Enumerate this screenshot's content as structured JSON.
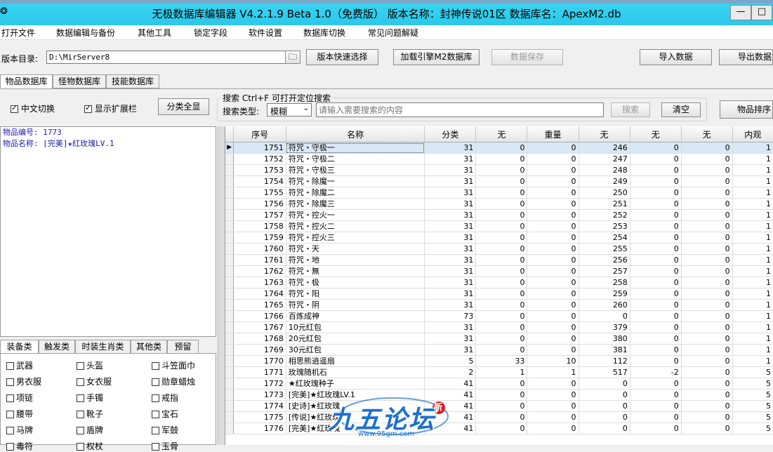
{
  "window": {
    "title": "无极数据库编辑器 V4.2.1.9    Beta 1.0（免费版）    版本名称：封神传说01区    数据库名：ApexM2.db",
    "minimize": "—",
    "maximize": "□"
  },
  "menu": [
    "打开文件",
    "数据编辑与备份",
    "其他工具",
    "锁定字段",
    "软件设置",
    "数据库切换",
    "常见问题解疑"
  ],
  "toolbar": {
    "dir_label": "版本目录:",
    "dir_value": "D:\\MirServer8",
    "quick_select": "版本快速选择",
    "load_db": "加载引擎M2数据库",
    "save_data": "数据保存",
    "import": "导入数据",
    "export": "导出数据"
  },
  "db_tabs": [
    "物品数据库",
    "怪物数据库",
    "技能数据库"
  ],
  "options": {
    "chinese_switch": "中文切换",
    "show_extension": "显示扩展栏",
    "show_all_categories": "分类全显"
  },
  "search": {
    "title": "搜索  Ctrl+F 可打开定位搜索",
    "type_label": "搜索类型:",
    "type_value": "模糊",
    "placeholder": "请输入需要搜索的内容",
    "search_btn": "搜索",
    "clear_btn": "清空",
    "sort_btn": "物品排序"
  },
  "info": {
    "line1": "物品编号: 1773",
    "line2": "物品名称: [完美]★红玫瑰LV.1"
  },
  "category_tabs": [
    "装备类",
    "触发类",
    "时装生肖类",
    "其他类",
    "预留"
  ],
  "category_items": [
    [
      "武器",
      "头盔",
      "斗笠面巾"
    ],
    [
      "男衣服",
      "女衣服",
      "勋章蜡烛"
    ],
    [
      "项链",
      "手镯",
      "戒指"
    ],
    [
      "腰带",
      "靴子",
      "宝石"
    ],
    [
      "马牌",
      "盾牌",
      "军鼓"
    ],
    [
      "毒符",
      "权杖",
      "玉骨"
    ]
  ],
  "grid": {
    "columns": [
      "序号",
      "名称",
      "分类",
      "无",
      "重量",
      "无",
      "无",
      "无",
      "内观"
    ],
    "rows": [
      [
        "1751",
        "符咒・守极一",
        "31",
        "0",
        "0",
        "246",
        "0",
        "0",
        "1"
      ],
      [
        "1752",
        "符咒・守极二",
        "31",
        "0",
        "0",
        "247",
        "0",
        "0",
        "1"
      ],
      [
        "1753",
        "符咒・守极三",
        "31",
        "0",
        "0",
        "248",
        "0",
        "0",
        "1"
      ],
      [
        "1754",
        "符咒・除魔一",
        "31",
        "0",
        "0",
        "249",
        "0",
        "0",
        "1"
      ],
      [
        "1755",
        "符咒・除魔二",
        "31",
        "0",
        "0",
        "250",
        "0",
        "0",
        "1"
      ],
      [
        "1756",
        "符咒・除魔三",
        "31",
        "0",
        "0",
        "251",
        "0",
        "0",
        "1"
      ],
      [
        "1757",
        "符咒・控火一",
        "31",
        "0",
        "0",
        "252",
        "0",
        "0",
        "1"
      ],
      [
        "1758",
        "符咒・控火二",
        "31",
        "0",
        "0",
        "253",
        "0",
        "0",
        "1"
      ],
      [
        "1759",
        "符咒・控火三",
        "31",
        "0",
        "0",
        "254",
        "0",
        "0",
        "1"
      ],
      [
        "1760",
        "符咒・天",
        "31",
        "0",
        "0",
        "255",
        "0",
        "0",
        "1"
      ],
      [
        "1761",
        "符咒・地",
        "31",
        "0",
        "0",
        "256",
        "0",
        "0",
        "1"
      ],
      [
        "1762",
        "符咒・無",
        "31",
        "0",
        "0",
        "257",
        "0",
        "0",
        "1"
      ],
      [
        "1763",
        "符咒・极",
        "31",
        "0",
        "0",
        "258",
        "0",
        "0",
        "1"
      ],
      [
        "1764",
        "符咒・阳",
        "31",
        "0",
        "0",
        "259",
        "0",
        "0",
        "1"
      ],
      [
        "1765",
        "符咒・阴",
        "31",
        "0",
        "0",
        "260",
        "0",
        "0",
        "1"
      ],
      [
        "1766",
        "百炼成神",
        "73",
        "0",
        "0",
        "0",
        "0",
        "0",
        "1"
      ],
      [
        "1767",
        "10元红包",
        "31",
        "0",
        "0",
        "379",
        "0",
        "0",
        "1"
      ],
      [
        "1768",
        "20元红包",
        "31",
        "0",
        "0",
        "380",
        "0",
        "0",
        "1"
      ],
      [
        "1769",
        "30元红包",
        "31",
        "0",
        "0",
        "381",
        "0",
        "0",
        "1"
      ],
      [
        "1770",
        "相思熊逍遥扇",
        "5",
        "33",
        "10",
        "112",
        "0",
        "0",
        "1"
      ],
      [
        "1771",
        "玫瑰随机石",
        "2",
        "1",
        "1",
        "517",
        "-2",
        "0",
        "5"
      ],
      [
        "1772",
        "★红玫瑰种子",
        "41",
        "0",
        "0",
        "0",
        "0",
        "0",
        "5"
      ],
      [
        "1773",
        "[完美]★红玫瑰LV.1",
        "41",
        "0",
        "0",
        "0",
        "0",
        "0",
        "5"
      ],
      [
        "1774",
        "[史诗]★红玫瑰",
        "41",
        "0",
        "0",
        "0",
        "0",
        "0",
        "5"
      ],
      [
        "1775",
        "[传说]★红玫瑰",
        "41",
        "0",
        "0",
        "0",
        "0",
        "0",
        "5"
      ],
      [
        "1776",
        "[完美]★红玫瑰",
        "41",
        "0",
        "0",
        "0",
        "0",
        "0",
        "5"
      ]
    ],
    "selected_row": 0
  },
  "watermark": {
    "text": "九五论坛",
    "url": "www.95gm.com",
    "badge": "新"
  }
}
